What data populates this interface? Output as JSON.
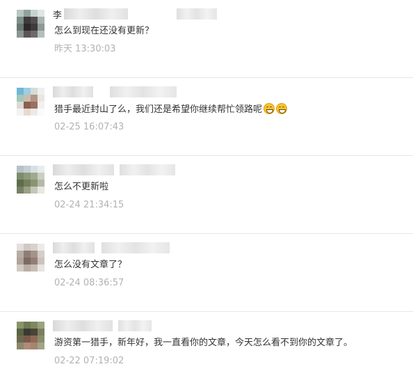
{
  "colors": {
    "comment_text": "#333333",
    "time_text": "#b2b2b2",
    "divider": "#e6e6e6"
  },
  "comments": [
    {
      "name_prefix": "李",
      "text": "怎么到现在还没有更新？",
      "time": "昨天 13:30:03",
      "emojis": []
    },
    {
      "name_prefix": "",
      "text": "猎手最近封山了么，我们还是希望你继续帮忙领路呢",
      "time": "02-25 16:07:43",
      "emojis": [
        "grin-emoji",
        "grin-emoji"
      ]
    },
    {
      "name_prefix": "",
      "text": "怎么不更新啦",
      "time": "02-24 21:34:15",
      "emojis": []
    },
    {
      "name_prefix": "",
      "text": "怎么没有文章了？",
      "time": "02-24 08:36:57",
      "emojis": []
    },
    {
      "name_prefix": "",
      "text": "游资第一猎手，新年好，我一直看你的文章，今天怎么看不到你的文章了。",
      "time": "02-22 07:19:02",
      "emojis": []
    }
  ]
}
